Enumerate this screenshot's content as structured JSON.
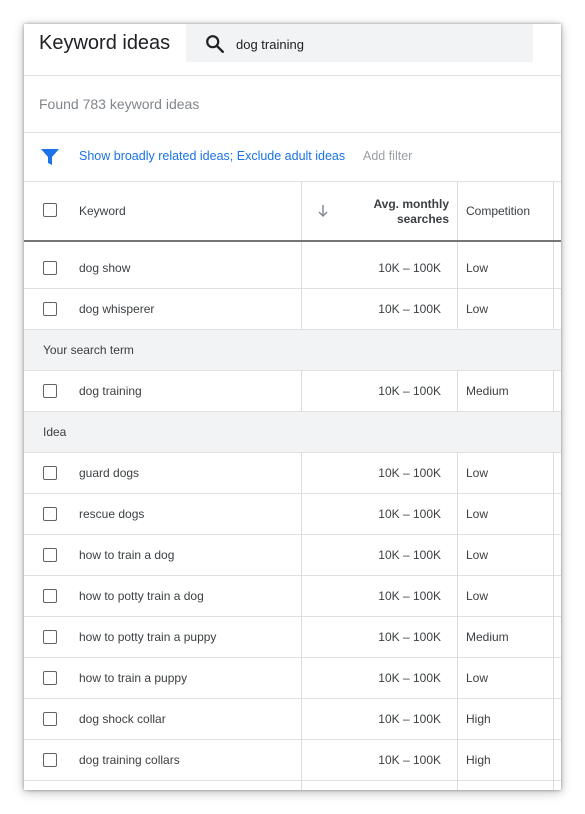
{
  "header": {
    "title": "Keyword ideas",
    "search_value": "dog training",
    "search_icon": "search-icon"
  },
  "summary": {
    "found_text": "Found 783 keyword ideas"
  },
  "filter_bar": {
    "filter_text": "Show broadly related ideas; Exclude adult ideas",
    "add_filter_label": "Add filter",
    "accent_color": "#1a73e8"
  },
  "table": {
    "columns": {
      "keyword": "Keyword",
      "volume_line1": "Avg. monthly",
      "volume_line2": "searches",
      "competition": "Competition"
    },
    "rows_top": [
      {
        "keyword": "dog show",
        "volume": "10K – 100K",
        "competition": "Low"
      },
      {
        "keyword": "dog whisperer",
        "volume": "10K – 100K",
        "competition": "Low"
      }
    ],
    "group_search_term": "Your search term",
    "rows_search_term": [
      {
        "keyword": "dog training",
        "volume": "10K – 100K",
        "competition": "Medium"
      }
    ],
    "group_idea": "Idea",
    "rows_idea": [
      {
        "keyword": "guard dogs",
        "volume": "10K – 100K",
        "competition": "Low"
      },
      {
        "keyword": "rescue dogs",
        "volume": "10K – 100K",
        "competition": "Low"
      },
      {
        "keyword": "how to train a dog",
        "volume": "10K – 100K",
        "competition": "Low"
      },
      {
        "keyword": "how to potty train a dog",
        "volume": "10K – 100K",
        "competition": "Low"
      },
      {
        "keyword": "how to potty train a puppy",
        "volume": "10K – 100K",
        "competition": "Medium"
      },
      {
        "keyword": "how to train a puppy",
        "volume": "10K – 100K",
        "competition": "Low"
      },
      {
        "keyword": "dog shock collar",
        "volume": "10K – 100K",
        "competition": "High"
      },
      {
        "keyword": "dog training collars",
        "volume": "10K – 100K",
        "competition": "High"
      }
    ]
  }
}
